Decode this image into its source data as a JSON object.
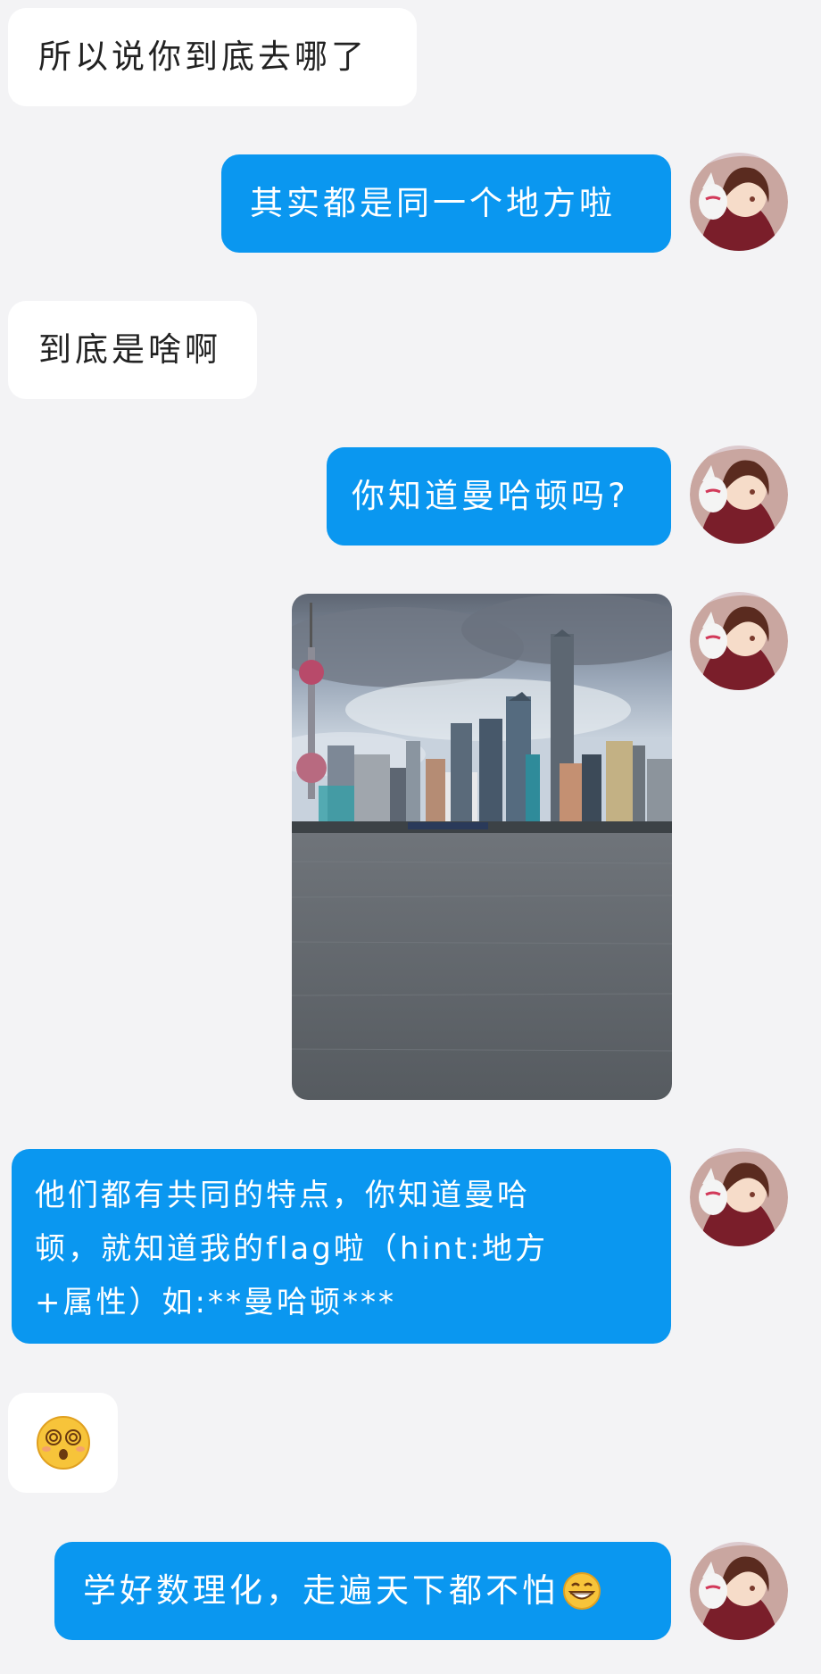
{
  "colors": {
    "background": "#f3f3f5",
    "incoming_bubble": "#ffffff",
    "outgoing_bubble": "#0a97f0",
    "outgoing_text": "#ffffff"
  },
  "messages": [
    {
      "side": "incoming",
      "type": "text",
      "text": "所以说你到底去哪了"
    },
    {
      "side": "outgoing",
      "type": "text",
      "text": "其实都是同一个地方啦"
    },
    {
      "side": "incoming",
      "type": "text",
      "text": "到底是啥啊"
    },
    {
      "side": "outgoing",
      "type": "text",
      "text": "你知道曼哈顿吗?"
    },
    {
      "side": "outgoing",
      "type": "image",
      "image": "city-skyline-river-photo"
    },
    {
      "side": "outgoing",
      "type": "text",
      "lines": [
        "他们都有共同的特点，你知道曼哈",
        "顿，就知道我的flag啦（hint:地方",
        "+属性）如:**曼哈顿***"
      ]
    },
    {
      "side": "incoming",
      "type": "emoji",
      "emoji": "dizzy-face-emoji"
    },
    {
      "side": "outgoing",
      "type": "text",
      "text": "学好数理化，走遍天下都不怕",
      "trailing_emoji": "grinning-face-emoji"
    }
  ],
  "avatar": {
    "icon": "anime-girl-fox-mask-avatar"
  }
}
